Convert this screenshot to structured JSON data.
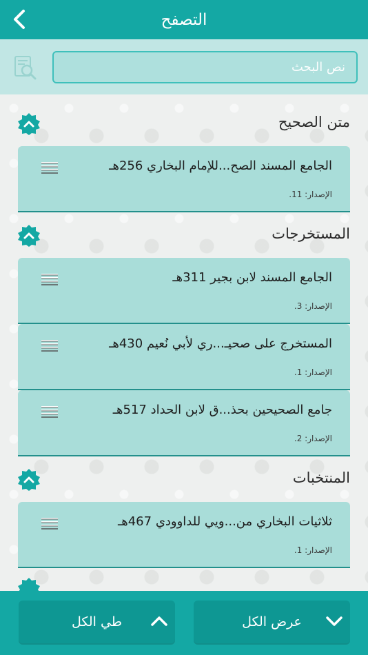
{
  "header": {
    "title": "التصفح"
  },
  "search": {
    "placeholder": "نص البحث"
  },
  "sections": [
    {
      "title": "متن الصحيح",
      "items": [
        {
          "title": "الجامع المسند الصح...للإمام البخاري 256هـ",
          "version": "الإصدار: 11."
        }
      ]
    },
    {
      "title": "المستخرجات",
      "items": [
        {
          "title": "الجامع المسند لابن بجير 311هـ",
          "version": "الإصدار: 3."
        },
        {
          "title": "المستخرج على صحيـ...ري لأبي نُعيم 430هـ",
          "version": "الإصدار: 1."
        },
        {
          "title": "جامع الصحيحين بحذ...ق لابن الحداد 517هـ",
          "version": "الإصدار: 2."
        }
      ]
    },
    {
      "title": "المنتخبات",
      "items": [
        {
          "title": "ثلاثيات البخاري من...ويي للداوودي 467هـ",
          "version": "الإصدار: 1."
        }
      ]
    }
  ],
  "bottom": {
    "collapse_all": "طي الكل",
    "expand_all": "عرض الكل"
  },
  "colors": {
    "primary": "#14a8a4",
    "card": "#a9ddd9",
    "search_bg": "#c1e6e4"
  }
}
